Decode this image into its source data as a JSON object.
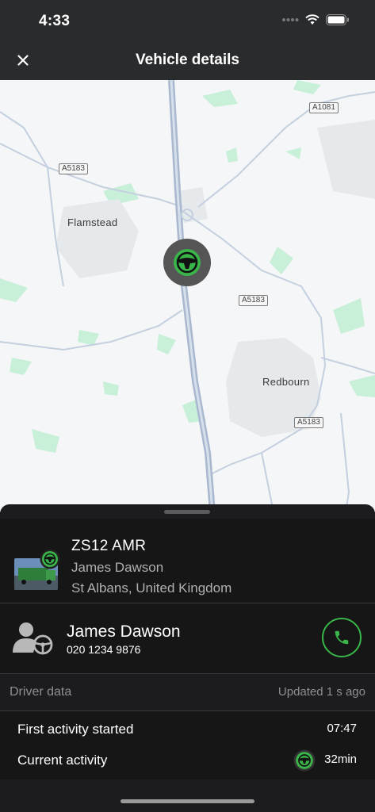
{
  "status_bar": {
    "time": "4:33"
  },
  "header": {
    "title": "Vehicle details",
    "close_icon": "close-icon"
  },
  "map": {
    "road_labels": [
      "A1081",
      "A5183",
      "A5183",
      "A5183"
    ],
    "places": [
      "Flamstead",
      "Redbourn"
    ],
    "marker_icon": "steering-wheel-icon"
  },
  "vehicle": {
    "plate": "ZS12 AMR",
    "driver": "James Dawson",
    "location": "St Albans, United Kingdom",
    "extra": "-",
    "status_color": "#39b54a"
  },
  "driver": {
    "name": "James Dawson",
    "phone": "020 1234 9876",
    "call_icon": "phone-icon"
  },
  "driver_data": {
    "title": "Driver data",
    "updated": "Updated 1 s ago",
    "rows": [
      {
        "label": "First activity started",
        "value": "07:47"
      },
      {
        "label": "Current activity",
        "value": "32min",
        "icon": "driving-icon"
      }
    ]
  },
  "colors": {
    "accent": "#39b54a",
    "sheet_bg": "#1c1c1e",
    "header_bg": "#2a2b2d"
  }
}
